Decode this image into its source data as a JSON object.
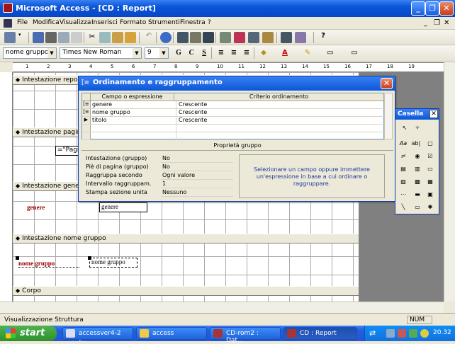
{
  "window": {
    "title": "Microsoft Access - [CD : Report]"
  },
  "menu": [
    "File",
    "Modifica",
    "Visualizza",
    "Inserisci",
    "Formato",
    "Strumenti",
    "Finestra",
    "?"
  ],
  "formatting": {
    "object": "nome gruppo",
    "font": "Times New Roman",
    "size": "9",
    "bold": "G",
    "italic": "C",
    "underline": "S"
  },
  "ruler_marks": [
    "1",
    "2",
    "3",
    "4",
    "5",
    "6",
    "7",
    "8",
    "9",
    "10",
    "11",
    "12",
    "13",
    "14",
    "15",
    "16",
    "17",
    "18",
    "19"
  ],
  "sections": {
    "report_header": "Intestazione report",
    "page_header": "Intestazione pagina",
    "genre_header": "Intestazione genere",
    "group_name_header": "Intestazione nome gruppo",
    "body": "Corpo"
  },
  "controls": {
    "page_expr": "=\"Pagi",
    "genre_label": "genere",
    "genre_field": "genere",
    "group_label": "nome gruppo",
    "group_field": "nome gruppo"
  },
  "dialog": {
    "title": "Ordinamento e raggruppamento",
    "col_field": "Campo o espressione",
    "col_order": "Criterio ordinamento",
    "rows": [
      {
        "field": "genere",
        "order": "Crescente",
        "marker": "[≡"
      },
      {
        "field": "nome gruppo",
        "order": "Crescente",
        "marker": "[≡"
      },
      {
        "field": "titolo",
        "order": "Crescente",
        "marker": "▶"
      }
    ],
    "props_title": "Proprietà gruppo",
    "props": [
      {
        "name": "Intestazione (gruppo)",
        "value": "No"
      },
      {
        "name": "Piè di pagina (gruppo)",
        "value": "No"
      },
      {
        "name": "Raggruppa secondo",
        "value": "Ogni valore"
      },
      {
        "name": "Intervallo raggruppam.",
        "value": "1"
      },
      {
        "name": "Stampa sezione unita",
        "value": "Nessuno"
      }
    ],
    "hint": "Selezionare un campo oppure immettere un'espressione in base a cui ordinare o raggruppare."
  },
  "toolbox": {
    "title": "Casella"
  },
  "status": {
    "text": "Visualizzazione Struttura",
    "num": "NUM"
  },
  "taskbar": {
    "start": "start",
    "tasks": [
      "accessver4-2 -...",
      "access",
      "CD-rom2 : Dat...",
      "CD : Report"
    ],
    "clock": "20.32"
  }
}
